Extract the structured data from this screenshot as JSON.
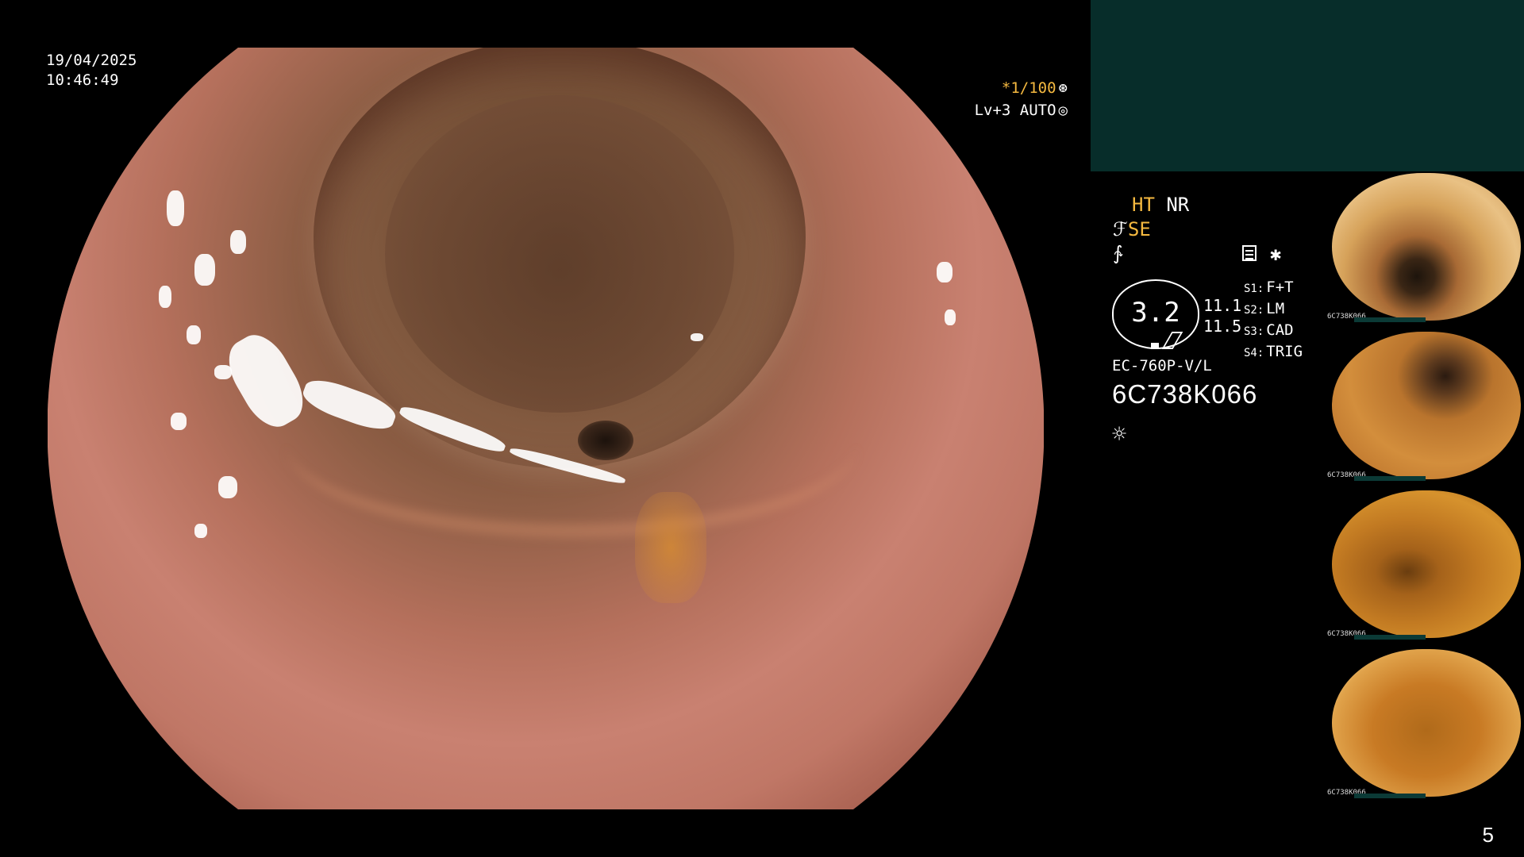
{
  "datetime": {
    "date": "19/04/2025",
    "time": "10:46:49"
  },
  "magnification": {
    "label": "*1/100",
    "icon": "shutter-icon"
  },
  "level": {
    "label": "Lv+3 AUTO",
    "icon": "iris-icon"
  },
  "modes": {
    "ht": "HT",
    "nr": "NR",
    "se": "SE"
  },
  "scope": {
    "value": "3.2",
    "readings": [
      "11.1",
      "11.5"
    ],
    "slots": [
      {
        "key": "S1:",
        "value": "F+T"
      },
      {
        "key": "S2:",
        "value": "LM"
      },
      {
        "key": "S3:",
        "value": "CAD"
      },
      {
        "key": "S4:",
        "value": "TRIG"
      }
    ],
    "model": "EC-760P-V/L",
    "serial": "6C738K066"
  },
  "thumbnails": [
    {
      "label": "6C738K066"
    },
    {
      "label": "6C738K066"
    },
    {
      "label": "6C738K066"
    },
    {
      "label": "6C738K066"
    }
  ],
  "page_number": "5",
  "colors": {
    "accent": "#f5b940",
    "panel": "#072d2a",
    "background": "#000000"
  }
}
